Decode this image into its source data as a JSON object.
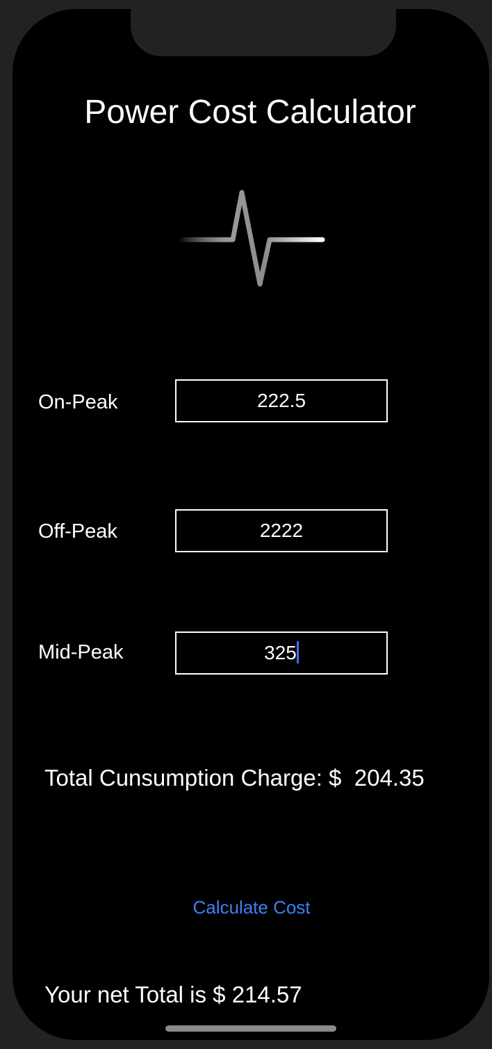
{
  "app": {
    "title": "Power Cost Calculator",
    "logo_icon": "pulse-waveform-icon"
  },
  "form": {
    "on_peak": {
      "label": "On-Peak",
      "value": "222.5"
    },
    "off_peak": {
      "label": "Off-Peak",
      "value": "2222"
    },
    "mid_peak": {
      "label": "Mid-Peak",
      "value": "325",
      "focused": true
    }
  },
  "results": {
    "consumption_label": "Total Cunsumption Charge: $",
    "consumption_value": "204.35",
    "calculate_label": "Calculate Cost",
    "net_total_label": "Your net Total is $",
    "net_total_value": "214.57"
  },
  "colors": {
    "background": "#000000",
    "frame": "#222222",
    "text": "#ffffff",
    "accent": "#3b82f6",
    "caret": "#4a6cf7"
  }
}
